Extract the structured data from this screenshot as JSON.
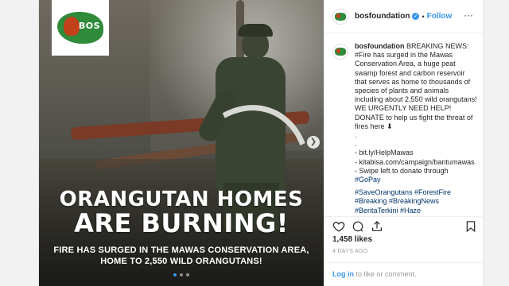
{
  "image": {
    "logo_text": "BOS",
    "headline_line1": "ORANGUTAN HOMES",
    "headline_line2": "ARE BURNING!",
    "subline_line1": "FIRE HAS SURGED IN THE MAWAS CONSERVATION AREA,",
    "subline_line2": "HOME TO 2,550 WILD ORANGUTANS!",
    "carousel_count": 3,
    "carousel_active": 1
  },
  "header": {
    "username": "bosfoundation",
    "separator": "•",
    "follow_label": "Follow",
    "more_label": "···"
  },
  "caption": {
    "username": "bosfoundation",
    "text": "BREAKING NEWS: #Fire has surged in the Mawas Conservation Area, a huge peat swamp forest and carbon reservoir that serves as home to thousands of species of plants and animals including about 2,550 wild orangutans! WE URGENTLY NEED HELP! DONATE to help us fight the threat of fires here",
    "emoji": "⬇",
    "dots": [
      ".",
      "."
    ],
    "links": [
      "- bit.ly/HelpMawas",
      "- kitabisa.com/campaign/bantumawas",
      "- Swipe left to donate through"
    ],
    "gopay": "#GoPay",
    "hashtags_line1": "#SaveOrangutans #ForestFire",
    "hashtags_line2": "#Breaking #BreakingNews",
    "hashtags_line3": "#BeritaTerkini #Haze"
  },
  "stats": {
    "likes": "1,458 likes",
    "time_ago": "4 DAYS AGO"
  },
  "footer": {
    "login_label": "Log in",
    "rest": " to like or comment."
  },
  "colors": {
    "accent": "#3897f0",
    "hashtag": "#003569",
    "text": "#262626",
    "muted": "#999999"
  }
}
